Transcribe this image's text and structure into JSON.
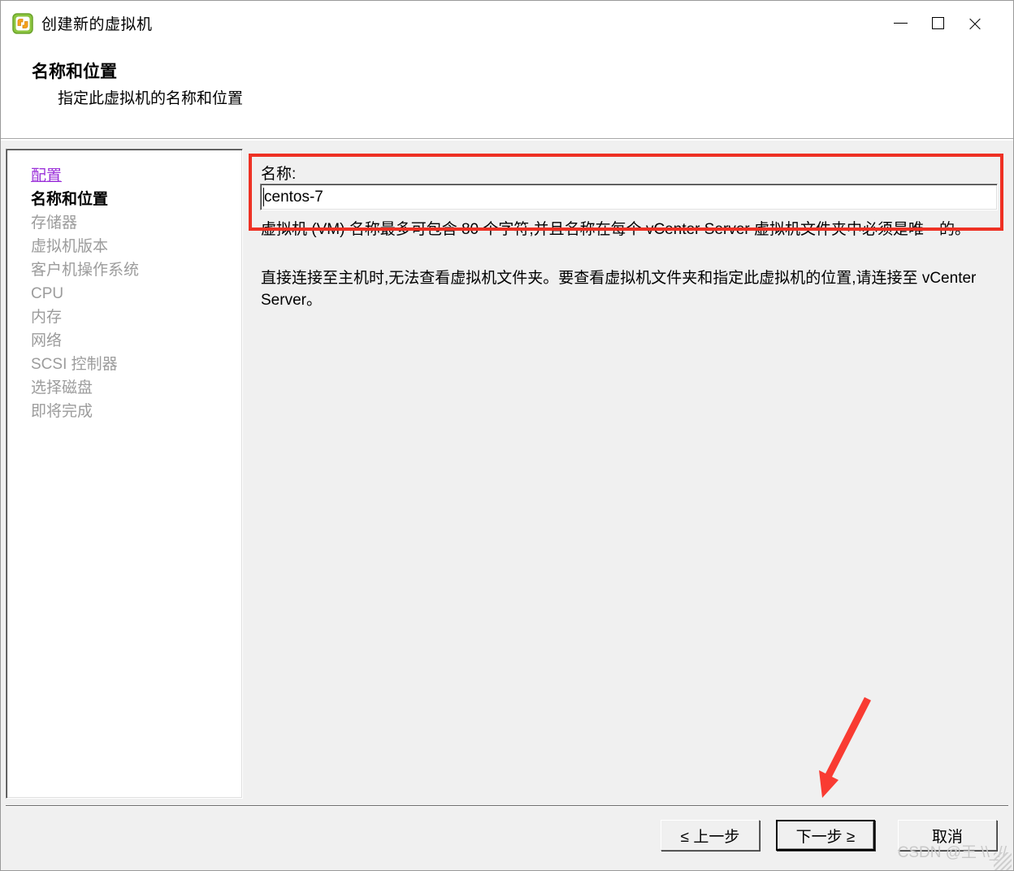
{
  "window": {
    "title": "创建新的虚拟机",
    "icon": "vm-icon",
    "controls": {
      "minimize": "minimize-icon",
      "maximize": "maximize-icon",
      "close": "close-icon"
    }
  },
  "header": {
    "title": "名称和位置",
    "subtitle": "指定此虚拟机的名称和位置"
  },
  "sidebar": {
    "items": [
      {
        "label": "配置",
        "state": "link"
      },
      {
        "label": "名称和位置",
        "state": "current"
      },
      {
        "label": "存储器",
        "state": "pending"
      },
      {
        "label": "虚拟机版本",
        "state": "pending"
      },
      {
        "label": "客户机操作系统",
        "state": "pending"
      },
      {
        "label": "CPU",
        "state": "pending"
      },
      {
        "label": "内存",
        "state": "pending"
      },
      {
        "label": "网络",
        "state": "pending"
      },
      {
        "label": "SCSI 控制器",
        "state": "pending"
      },
      {
        "label": "选择磁盘",
        "state": "pending"
      },
      {
        "label": "即将完成",
        "state": "pending"
      }
    ]
  },
  "form": {
    "name_label": "名称:",
    "name_value": "centos-7",
    "name_placeholder": "",
    "description_1": "虚拟机 (VM) 名称最多可包含 80 个字符,并且名称在每个 vCenter Server 虚拟机文件夹中必须是唯一的。",
    "description_2": "直接连接至主机时,无法查看虚拟机文件夹。要查看虚拟机文件夹和指定此虚拟机的位置,请连接至 vCenter Server。"
  },
  "footer": {
    "back_label": "≤ 上一步",
    "next_label": "下一步 ≥",
    "cancel_label": "取消",
    "watermark": "CSDN @王 \\\\_//"
  },
  "annotations": {
    "highlight_color": "#ee3124",
    "arrow_color": "#f93b32",
    "highlight_target": "name-field-group",
    "arrow_target": "next-button"
  }
}
